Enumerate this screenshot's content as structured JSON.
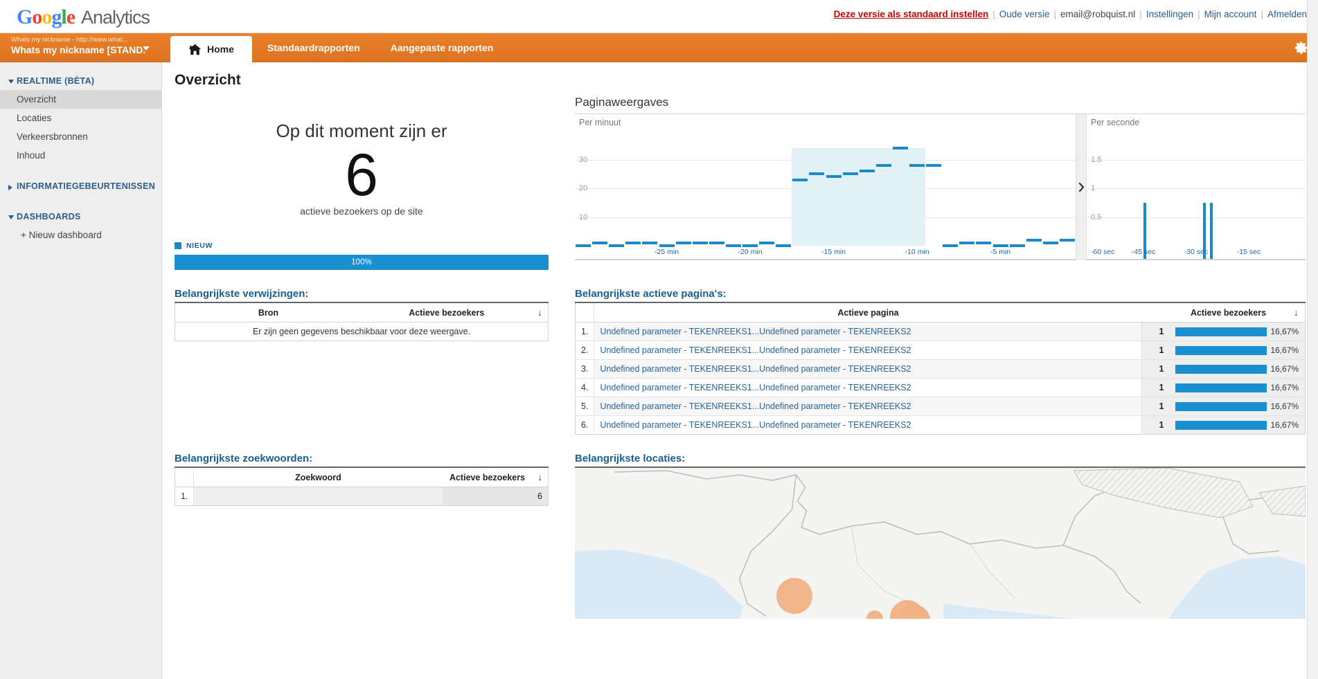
{
  "brand": {
    "google": [
      "G",
      "o",
      "o",
      "g",
      "l",
      "e"
    ],
    "product": "Analytics"
  },
  "topnav": {
    "set_default": "Deze versie als standaard instellen",
    "old_version": "Oude versie",
    "email": "email@robquist.nl",
    "settings": "Instellingen",
    "my_account": "Mijn account",
    "sign_out": "Afmelden",
    "separator": "|"
  },
  "account_selector": {
    "line1": "Whats my nickname - http://www.what...",
    "line2": "Whats my nickname [STAND...",
    "icon": "chevron-down-icon"
  },
  "tabs": [
    {
      "label": "Home",
      "active": true,
      "icon": "home-icon"
    },
    {
      "label": "Standaardrapporten",
      "active": false
    },
    {
      "label": "Aangepaste rapporten",
      "active": false
    }
  ],
  "gear": {
    "icon": "gear-icon"
  },
  "sidebar": {
    "groups": [
      {
        "label": "REALTIME (BÈTA)",
        "expanded": true,
        "items": [
          {
            "label": "Overzicht",
            "selected": true
          },
          {
            "label": "Locaties",
            "selected": false
          },
          {
            "label": "Verkeersbronnen",
            "selected": false
          },
          {
            "label": "Inhoud",
            "selected": false
          }
        ]
      },
      {
        "label": "INFORMATIEGEBEURTENISSEN",
        "expanded": false,
        "items": []
      },
      {
        "label": "DASHBOARDS",
        "expanded": true,
        "links": [
          {
            "label": "+ Nieuw dashboard"
          }
        ]
      }
    ]
  },
  "page": {
    "title": "Overzicht"
  },
  "counter": {
    "lead": "Op dit moment zijn er",
    "value": "6",
    "sub": "actieve bezoekers op de site",
    "legend_label": "NIEUW",
    "legend_color": "#1c8ac9",
    "bar_label": "100%",
    "bar_percent": 100
  },
  "pageviews": {
    "title": "Paginaweergaves",
    "per_minute_label": "Per minuut",
    "per_second_label": "Per seconde",
    "expander_icon": "chevron-right-icon"
  },
  "referrals": {
    "title": "Belangrijkste verwijzingen:",
    "columns": [
      "Bron",
      "Actieve bezoekers"
    ],
    "sort_icon": "sort-desc-arrow",
    "empty_message": "Er zijn geen gegevens beschikbaar voor deze weergave."
  },
  "active_pages": {
    "title": "Belangrijkste actieve pagina's:",
    "columns": [
      "Actieve pagina",
      "Actieve bezoekers"
    ],
    "sort_icon": "sort-desc-arrow",
    "rows": [
      {
        "index": "1.",
        "page": "Undefined parameter - TEKENREEKS1...Undefined parameter - TEKENREEKS2",
        "visitors": "1",
        "percent": "16,67%",
        "percent_value": 16.67
      },
      {
        "index": "2.",
        "page": "Undefined parameter - TEKENREEKS1...Undefined parameter - TEKENREEKS2",
        "visitors": "1",
        "percent": "16,67%",
        "percent_value": 16.67
      },
      {
        "index": "3.",
        "page": "Undefined parameter - TEKENREEKS1...Undefined parameter - TEKENREEKS2",
        "visitors": "1",
        "percent": "16,67%",
        "percent_value": 16.67
      },
      {
        "index": "4.",
        "page": "Undefined parameter - TEKENREEKS1...Undefined parameter - TEKENREEKS2",
        "visitors": "1",
        "percent": "16,67%",
        "percent_value": 16.67
      },
      {
        "index": "5.",
        "page": "Undefined parameter - TEKENREEKS1...Undefined parameter - TEKENREEKS2",
        "visitors": "1",
        "percent": "16,67%",
        "percent_value": 16.67
      },
      {
        "index": "6.",
        "page": "Undefined parameter - TEKENREEKS1...Undefined parameter - TEKENREEKS2",
        "visitors": "1",
        "percent": "16,67%",
        "percent_value": 16.67
      }
    ]
  },
  "keywords": {
    "title": "Belangrijkste zoekwoorden:",
    "columns": [
      "Zoekwoord",
      "Actieve bezoekers"
    ],
    "sort_icon": "sort-desc-arrow",
    "rows": [
      {
        "index": "1.",
        "keyword": "",
        "visitors": "6"
      }
    ]
  },
  "locations": {
    "title": "Belangrijkste locaties:",
    "map_markers": [
      {
        "x": 0.3,
        "y": 0.84,
        "r": 26
      },
      {
        "x": 0.41,
        "y": 0.99,
        "r": 12
      },
      {
        "x": 0.455,
        "y": 0.98,
        "r": 25
      },
      {
        "x": 0.465,
        "y": 1.0,
        "r": 22
      }
    ]
  },
  "chart_data": [
    {
      "type": "bar",
      "title": "Paginaweergaves",
      "subtitle": "Per minuut",
      "xlabel": "",
      "ylabel": "",
      "ylim": [
        0,
        40
      ],
      "yticks": [
        10,
        20,
        30
      ],
      "grid": true,
      "xticks": [
        "-25 min",
        "-20 min",
        "-15 min",
        "-10 min",
        "-5 min"
      ],
      "x": [
        -30,
        -29,
        -28,
        -27,
        -26,
        -25,
        -24,
        -23,
        -22,
        -21,
        -20,
        -19,
        -18,
        -17,
        -16,
        -15,
        -14,
        -13,
        -12,
        -11,
        -10,
        -9,
        -8,
        -7,
        -6,
        -5,
        -4,
        -3,
        -2,
        -1
      ],
      "values": [
        0,
        1,
        0,
        1,
        1,
        0,
        1,
        1,
        1,
        0,
        0,
        1,
        0,
        23,
        25,
        24,
        25,
        26,
        28,
        34,
        28,
        28,
        0,
        1,
        1,
        0,
        0,
        2,
        1,
        2
      ],
      "highlight_range": [
        -17,
        -10
      ],
      "series_color": "#1c8ac9",
      "fill_color": "#e2f0f8"
    },
    {
      "type": "bar",
      "title": "Paginaweergaves",
      "subtitle": "Per seconde",
      "xlabel": "",
      "ylabel": "",
      "ylim": [
        0,
        2
      ],
      "yticks": [
        0.5,
        1,
        1.5
      ],
      "grid": true,
      "xticks": [
        "-60 sec",
        "-45 sec",
        "-30 sec",
        "-15 sec"
      ],
      "x": [
        -45,
        -28,
        -26
      ],
      "values": [
        1,
        1,
        1
      ],
      "series_color": "#1c8ac9"
    }
  ]
}
